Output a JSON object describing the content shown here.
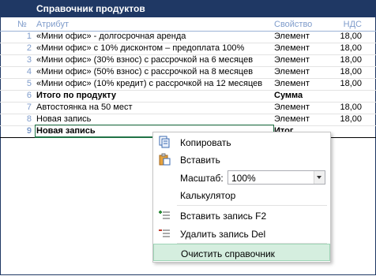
{
  "title": "Справочник продуктов",
  "columns": {
    "num": "№",
    "attr": "Атрибут",
    "prop": "Свойство",
    "vat": "НДС"
  },
  "rows": [
    {
      "num": "1",
      "attr": "«Мини офис» - долгосрочная аренда",
      "prop": "Элемент",
      "vat": "18,00"
    },
    {
      "num": "2",
      "attr": "«Мини офис» с 10% дисконтом – предоплата 100%",
      "prop": "Элемент",
      "vat": "18,00"
    },
    {
      "num": "3",
      "attr": "«Мини офис» (30% взнос) с рассрочкой на 6 месяцев",
      "prop": "Элемент",
      "vat": "18,00"
    },
    {
      "num": "4",
      "attr": "«Мини офис» (50% взнос) с рассрочкой на 8 месяцев",
      "prop": "Элемент",
      "vat": "18,00"
    },
    {
      "num": "5",
      "attr": "«Мини офис» (10% кредит) с рассрочкой на 12 месяцев",
      "prop": "Элемент",
      "vat": "18,00"
    },
    {
      "num": "6",
      "attr": "Итого по продукту",
      "prop": "Сумма",
      "vat": ""
    },
    {
      "num": "7",
      "attr": "Автостоянка на 50 мест",
      "prop": "Элемент",
      "vat": "18,00"
    },
    {
      "num": "8",
      "attr": "Новая запись",
      "prop": "Элемент",
      "vat": "18,00"
    },
    {
      "num": "9",
      "attr": "Новая запись",
      "prop": "Итог",
      "vat": ""
    }
  ],
  "menu": {
    "copy": "Копировать",
    "paste": "Вставить",
    "scale_label": "Масштаб:",
    "scale_value": "100%",
    "calculator": "Калькулятор",
    "insert_record": "Вставить запись F2",
    "delete_record": "Удалить запись   Del",
    "clear": "Очистить справочник"
  }
}
